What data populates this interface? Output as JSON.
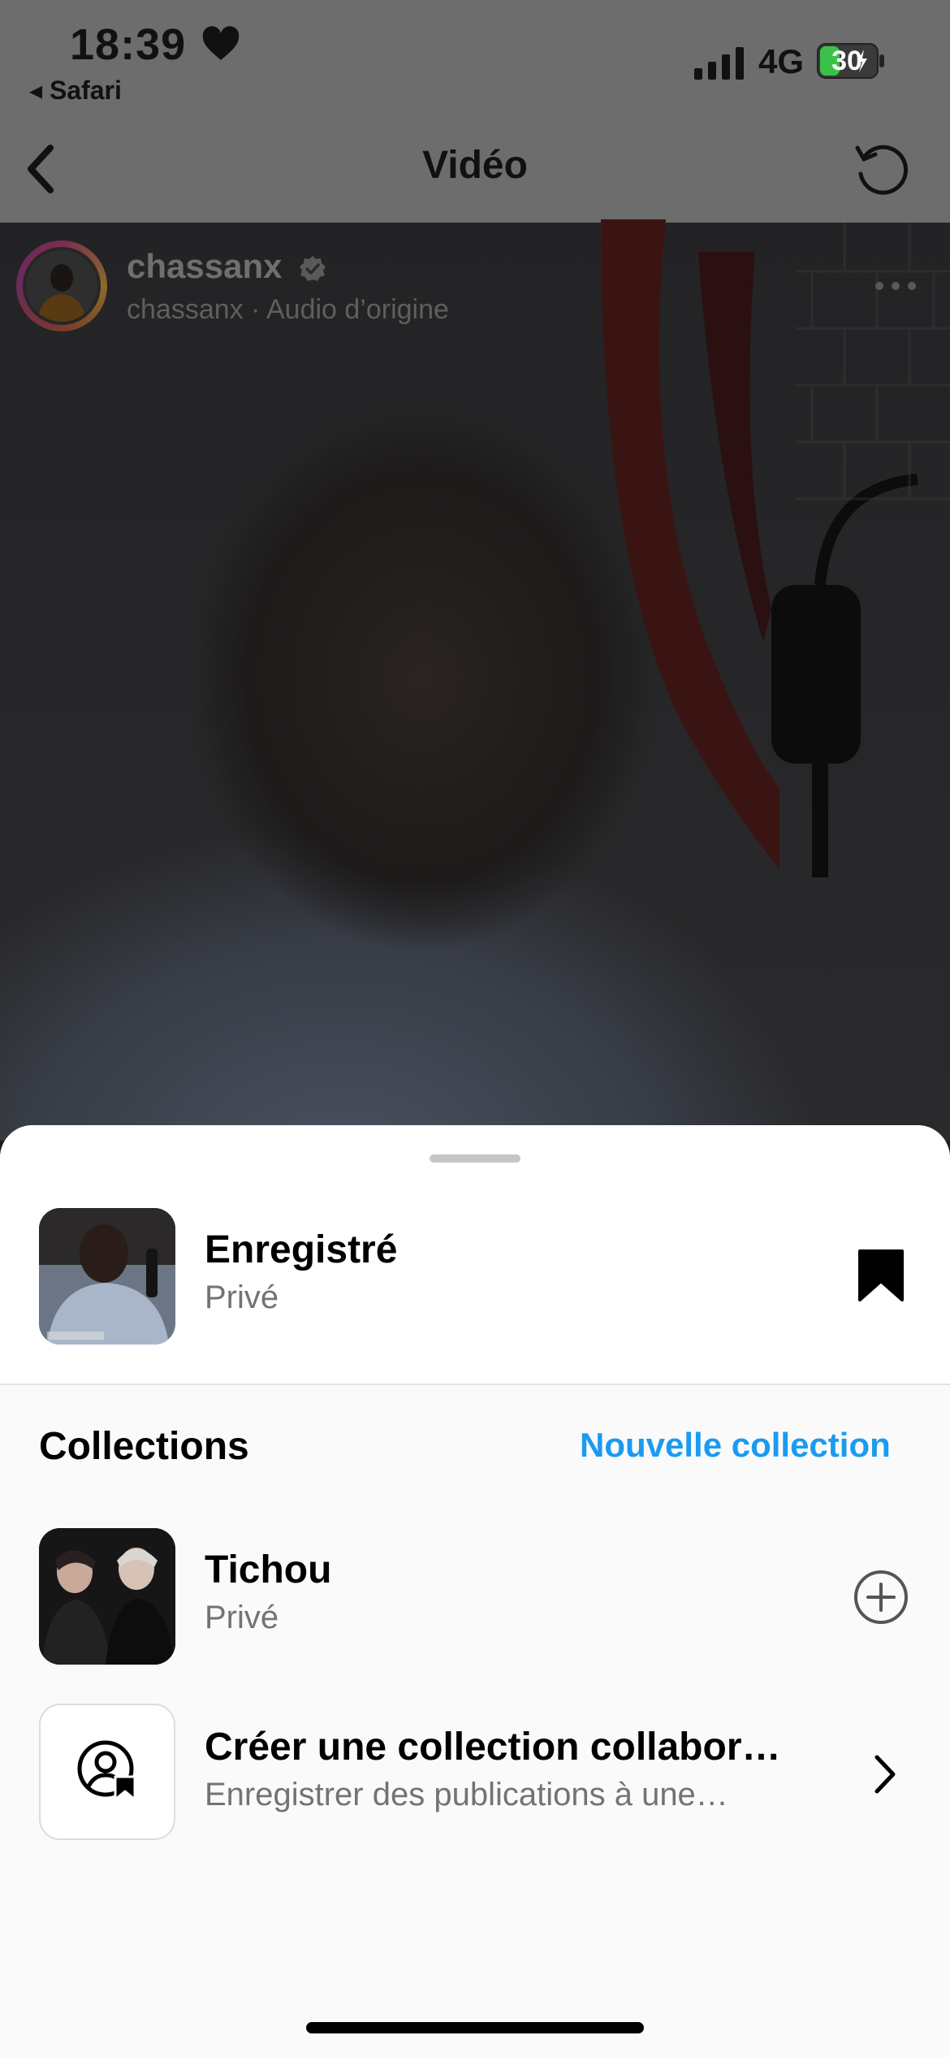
{
  "status_bar": {
    "time": "18:39",
    "back_app": "◂ Safari",
    "network": "4G",
    "battery": "30"
  },
  "header": {
    "title": "Vidéo"
  },
  "post": {
    "username": "chassanx",
    "subline": "chassanx · Audio d’origine"
  },
  "sheet": {
    "saved": {
      "title": "Enregistré",
      "privacy": "Privé"
    },
    "collections_heading": "Collections",
    "new_collection_label": "Nouvelle collection",
    "collections": [
      {
        "title": "Tichou",
        "privacy": "Privé"
      }
    ],
    "collaborative": {
      "title": "Créer une collection collabor…",
      "subtitle": "Enregistrer des publications à une…"
    }
  },
  "colors": {
    "accent": "#1a9bf0",
    "secondary_text": "#737373"
  },
  "icons": [
    "heart-icon",
    "signal-icon",
    "battery-icon",
    "back-chevron-icon",
    "refresh-icon",
    "verified-icon",
    "more-icon",
    "bookmark-icon",
    "add-circle-icon",
    "collaborative-user-icon",
    "chevron-right-icon"
  ]
}
